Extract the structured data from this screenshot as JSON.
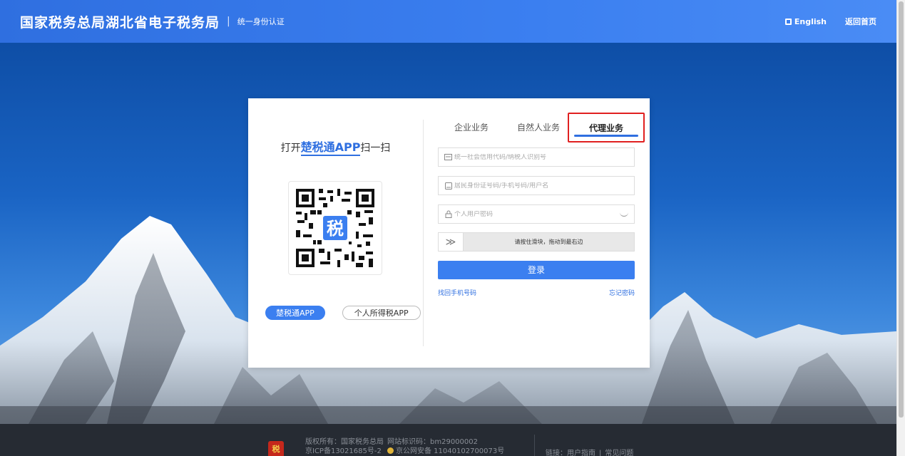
{
  "header": {
    "title": "国家税务总局湖北省电子税务局",
    "separator": "|",
    "subtitle": "统一身份认证",
    "lang_label": "English",
    "home_label": "返回首页"
  },
  "qr": {
    "prefix": "打开",
    "app_name": "楚税通APP",
    "suffix": "扫一扫",
    "center_char": "税"
  },
  "app_buttons": {
    "primary": "楚税通APP",
    "secondary": "个人所得税APP"
  },
  "tabs": {
    "t1": "企业业务",
    "t2": "自然人业务",
    "t3": "代理业务",
    "active": "代理业务"
  },
  "form": {
    "credit_code_placeholder": "统一社会信用代码/纳税人识别号",
    "id_placeholder": "居民身份证号码/手机号码/用户名",
    "password_placeholder": "个人用户密码",
    "slider_hint": "请按住滑块，拖动到最右边",
    "slider_glyph": "≫",
    "login_label": "登录",
    "recover_phone": "找回手机号码",
    "forgot_password": "忘记密码"
  },
  "footer": {
    "emblem_char": "税",
    "copyright": "版权所有：国家税务总局",
    "icp": "京ICP备13021685号-2",
    "site_id": "网站标识码：bm29000002",
    "police": "京公网安备 11040102700073号",
    "links_prefix": "链接：",
    "guide": "用户指南",
    "bar": "|",
    "faq": "常见问题"
  },
  "colors": {
    "brand": "#3b7ff0",
    "highlight_border": "#e02020",
    "footer_bg": "#262b33"
  }
}
